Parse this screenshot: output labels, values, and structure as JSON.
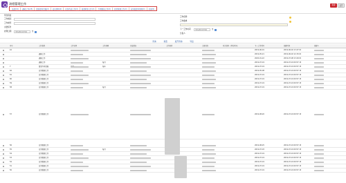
{
  "app": {
    "title": "流程管理工作",
    "btn_primary": "新建",
    "btn_secondary": "返回"
  },
  "tabs": [
    "全部(10)",
    "通知工作(25)",
    "督查督导台账(0)",
    "会议事项(0)",
    "任务传达工作(0)",
    "监督检查工作(0)",
    "专项整治工作(0)",
    "日常管理工作(0)",
    "业务类督导事项(0)",
    "全部(0)"
  ],
  "form": {
    "left": {
      "f1": "紧急程度",
      "f2": "工作类别",
      "f3": "工作类型",
      "f4": "主要任务",
      "f5": "办理日期"
    },
    "right": {
      "f1": "工作名称",
      "f2": "工作要求",
      "f3": "下一工作时间",
      "f4": "分发人"
    },
    "date_placeholder": "请选择时间范围",
    "to_text": "至"
  },
  "toolbar": {
    "query": "查询",
    "reset": "重置",
    "expand": "展开查询",
    "export": "导出"
  },
  "columns": [
    "序号",
    "工作类型",
    "工作名称",
    "工作周期",
    "完成情况",
    "工作要求",
    "主要任务",
    "有关领导（单位时间）",
    "下一工作时间",
    "创建时间",
    "创建人"
  ],
  "rows": [
    {
      "n": "10",
      "type": "",
      "name": "",
      "cycle": "",
      "next": "2019-06-01",
      "created": "2019-06-02 13:27:00"
    },
    {
      "n": "",
      "type": "通知工作",
      "name": "",
      "cycle": "",
      "next": "2019-05-21",
      "created": "2019-06-02 12:15:00"
    },
    {
      "n": "",
      "type": "通知工作",
      "name": "",
      "cycle": "",
      "next": "2020-01-22",
      "created": "2019-07-08 13:20:00"
    },
    {
      "n": "",
      "type": "通知工作",
      "name": "",
      "cycle": "每月",
      "next": "2019-07-19",
      "created": "2019-07-19 09:57:16"
    },
    {
      "n": "7",
      "type": "督查专项台账",
      "name": "日常",
      "cycle": "每年",
      "next": "2019-07-19",
      "created": "2019-07-19 09:57:16"
    },
    {
      "n": "62",
      "type": "日常管理工作",
      "name": "",
      "cycle": "",
      "next": "2019-05-08",
      "created": "2019-07-19 09:57:16"
    },
    {
      "n": "61",
      "type": "日常管理工作",
      "name": "",
      "cycle": "",
      "next": "2019-07-19",
      "created": "2019-07-19 09:57:16"
    },
    {
      "n": "60",
      "type": "日常管理工作",
      "name": "",
      "cycle": "",
      "next": "2019-07-19",
      "created": "2019-07-19 09:57:16"
    },
    {
      "n": "59",
      "type": "日常管理工作",
      "name": "",
      "cycle": "",
      "next": "2019-07-19",
      "created": "2019-07-19 09:57:16"
    },
    {
      "n": "58",
      "type": "日常管理工作",
      "name": "",
      "cycle": "每月",
      "next": "2019-07-19",
      "created": "2019-07-19 09:57:16"
    },
    {
      "n": "57",
      "type": "日常管理工作",
      "name": "",
      "cycle": "",
      "next": "2019-08-20",
      "created": "2019-07-19 09:57:16"
    },
    {
      "n": "56",
      "type": "日常管理工作",
      "name": "",
      "cycle": "",
      "next": "2019-08-25",
      "created": "2019-07-19 09:57:16"
    },
    {
      "n": "55",
      "type": "日常管理工作",
      "name": "",
      "cycle": "每月",
      "next": "2019-07-03",
      "created": "2019-07-19 09:57:16"
    },
    {
      "n": "54",
      "type": "日常管理工作",
      "name": "",
      "cycle": "",
      "next": "2019-07-19",
      "created": "2019-07-19 09:57:16"
    },
    {
      "n": "53",
      "type": "日常管理工作",
      "name": "",
      "cycle": "",
      "next": "2019-07-19",
      "created": "2019-07-19 09:57:16"
    },
    {
      "n": "52",
      "type": "日常管理工作",
      "name": "",
      "cycle": "",
      "next": "2019-07-19",
      "created": "2019-07-19 09:57:16"
    },
    {
      "n": "51",
      "type": "日常管理工作",
      "name": "",
      "cycle": "",
      "next": "2019-07-19",
      "created": "2019-07-19 09:57:16"
    },
    {
      "n": "50",
      "type": "日常管理工作",
      "name": "",
      "cycle": "",
      "next": "2019-07-19",
      "created": "2019-07-19 09:57:16"
    }
  ]
}
